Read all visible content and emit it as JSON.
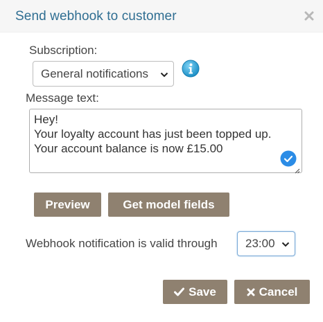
{
  "dialog": {
    "title": "Send webhook to customer",
    "close_icon": "close-icon"
  },
  "subscription": {
    "label": "Subscription:",
    "selected": "General notifications",
    "info_icon": "info-icon"
  },
  "message": {
    "label": "Message text:",
    "text": "Hey!\nYour loyalty account has just been topped up.\nYour account balance is now £15.00",
    "check_icon": "check-circle-icon"
  },
  "actions": {
    "preview_label": "Preview",
    "model_fields_label": "Get model fields"
  },
  "validity": {
    "label": "Webhook notification is valid through",
    "selected_time": "23:00"
  },
  "footer": {
    "save_label": "Save",
    "save_icon": "checkmark-icon",
    "cancel_label": "Cancel",
    "cancel_icon": "x-icon"
  },
  "colors": {
    "title_text": "#2f6e92",
    "button_bg": "#8f8170",
    "check_badge": "#2b8ce6",
    "info_icon": "#2aa3d8"
  }
}
